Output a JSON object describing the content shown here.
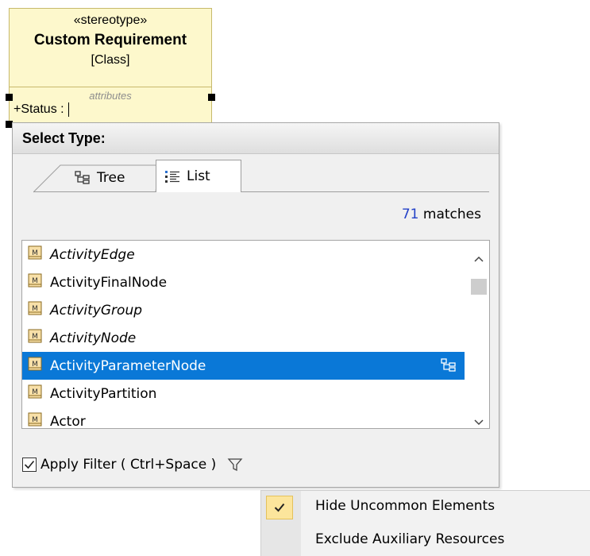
{
  "class_shape": {
    "stereotype": "«stereotype»",
    "name": "Custom Requirement",
    "kind": "[Class]",
    "attributes_title": "attributes",
    "attribute_prefix": "+Status :"
  },
  "popup": {
    "title": "Select Type:",
    "tabs": [
      {
        "label": "Tree",
        "icon": "tree-icon"
      },
      {
        "label": "List",
        "icon": "list-icon",
        "active": true
      }
    ],
    "matches_count": "71",
    "matches_label": "matches",
    "items": [
      {
        "label": "ActivityEdge",
        "italic": true,
        "selected": false
      },
      {
        "label": "ActivityFinalNode",
        "italic": false,
        "selected": false
      },
      {
        "label": "ActivityGroup",
        "italic": true,
        "selected": false
      },
      {
        "label": "ActivityNode",
        "italic": true,
        "selected": false
      },
      {
        "label": "ActivityParameterNode",
        "italic": false,
        "selected": true
      },
      {
        "label": "ActivityPartition",
        "italic": false,
        "selected": false
      },
      {
        "label": "Actor",
        "italic": false,
        "selected": false
      }
    ],
    "apply_filter": {
      "label": "Apply Filter ( Ctrl+Space )",
      "checked": true
    }
  },
  "filter_menu": {
    "items": [
      {
        "label": "Hide Uncommon Elements",
        "checked": true
      },
      {
        "label": "Exclude Auxiliary Resources",
        "checked": false
      }
    ]
  },
  "colors": {
    "selection": "#0a78d7",
    "class_fill": "#fdf8cc",
    "matches_number": "#2341c8",
    "menu_check_bg": "#fce59c"
  }
}
